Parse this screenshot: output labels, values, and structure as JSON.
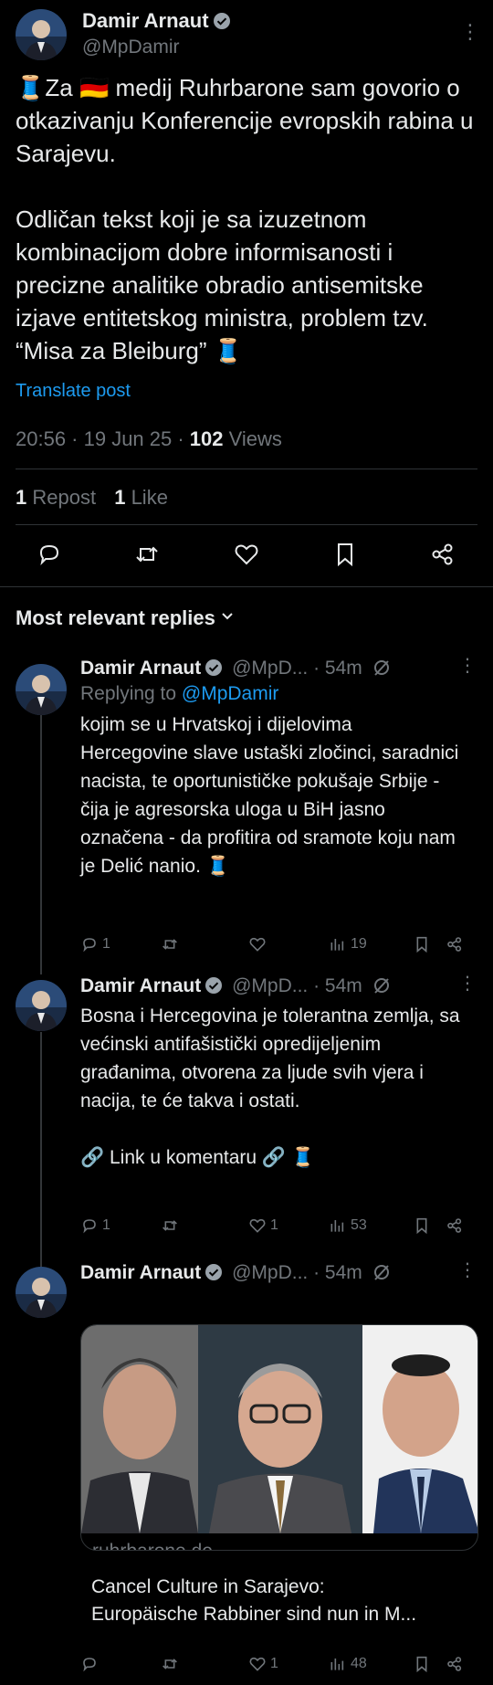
{
  "main": {
    "author_name": "Damir Arnaut",
    "author_handle": "@MpDamir",
    "more_label": "⋮",
    "text": "🧵Za 🇩🇪 medij Ruhrbarone sam govorio o otkazivanju Konferencije evropskih rabina u Sarajevu.\n\nOdličan tekst koji je sa izuzetnom kombinacijom dobre informisanosti i precizne analitike obradio antisemitske izjave entitetskog ministra, problem tzv. “Misa za Bleiburg” 🧵",
    "translate": "Translate post",
    "time": "20:56 · 19 Jun 25 · ",
    "views_count": "102",
    "views_label": " Views",
    "reposts_count": "1",
    "reposts_label": " Repost",
    "likes_count": "1",
    "likes_label": " Like"
  },
  "replies_header": "Most relevant replies",
  "replies": [
    {
      "name": "Damir Arnaut",
      "handle": "@MpD...",
      "time": " · 54m",
      "replying_prefix": "Replying to ",
      "replying_to": "@MpDamir",
      "text": "kojim se u Hrvatskoj i dijelovima Hercegovine slave ustaški zločinci, saradnici nacista, te oportunističke pokušaje Srbije - čija je agresorska uloga u BiH jasno označena - da profitira od sramote koju nam je Delić nanio. 🧵",
      "reply_count": "1",
      "like_count": "",
      "view_count": "19"
    },
    {
      "name": "Damir Arnaut",
      "handle": "@MpD...",
      "time": " · 54m",
      "text": "Bosna i Hercegovina je tolerantna zemlja, sa većinski antifašistički opredijeljenim građanima, otvorena za ljude svih vjera i nacija, te će takva i ostati.\n\n🔗 Link u komentaru 🔗 🧵",
      "reply_count": "1",
      "like_count": "1",
      "view_count": "53"
    },
    {
      "name": "Damir Arnaut",
      "handle": "@MpD...",
      "time": " · 54m",
      "card_domain": "ruhrbarone.de",
      "card_title_1": "Cancel Culture in Sarajevo:",
      "card_title_2": "Europäische Rabbiner sind nun in M...",
      "reply_count": "",
      "like_count": "1",
      "view_count": "48"
    }
  ],
  "colors": {
    "background": "#000000",
    "text": "#e7e9ea",
    "muted": "#71767b",
    "link": "#1d9bf0",
    "border": "#2f3336"
  }
}
